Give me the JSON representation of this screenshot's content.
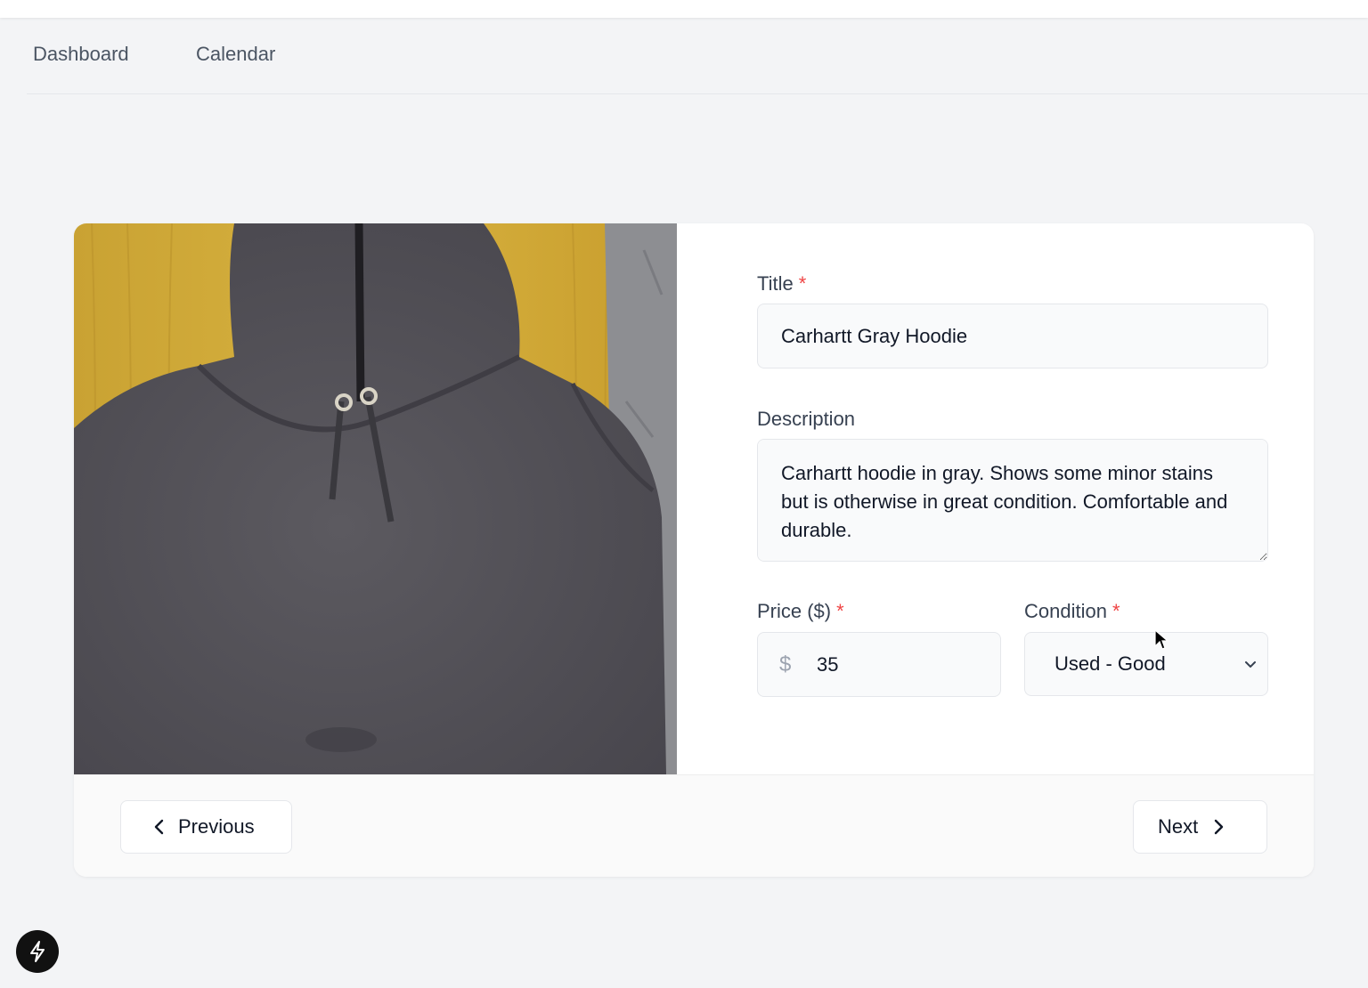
{
  "nav": {
    "dashboard": "Dashboard",
    "calendar": "Calendar"
  },
  "form": {
    "title_label": "Title",
    "title_value": "Carhartt Gray Hoodie",
    "description_label": "Description",
    "description_value": "Carhartt hoodie in gray. Shows some minor stains but is otherwise in great condition. Comfortable and durable.",
    "price_label": "Price ($)",
    "currency_symbol": "$",
    "price_value": "35",
    "condition_label": "Condition",
    "condition_value": "Used - Good",
    "required_marker": "*"
  },
  "footer": {
    "previous_label": "Previous",
    "next_label": "Next"
  },
  "icons": {
    "previous": "chevron-left-icon",
    "next": "chevron-right-icon",
    "select": "chevron-down-icon",
    "assistant": "lightning-bolt-icon"
  },
  "colors": {
    "required": "#ef4444",
    "background": "#f3f4f6",
    "card": "#ffffff"
  }
}
